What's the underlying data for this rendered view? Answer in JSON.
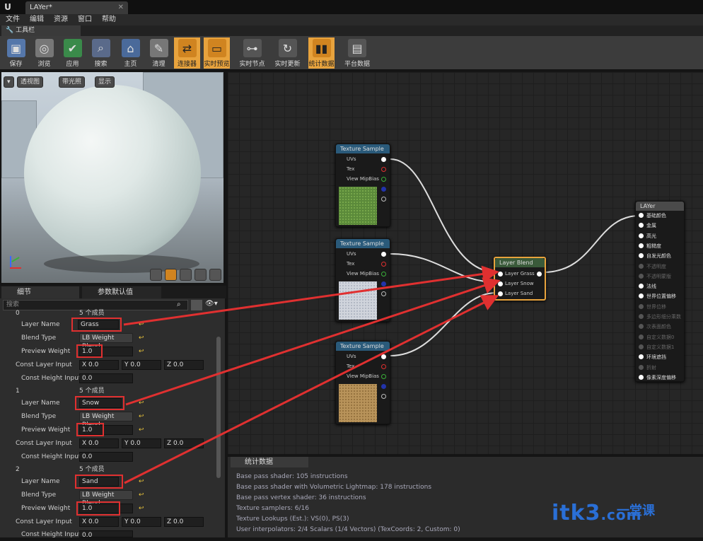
{
  "window": {
    "tab_title": "LAYer*",
    "logo": "U"
  },
  "menu": [
    "文件",
    "编辑",
    "资源",
    "窗口",
    "帮助"
  ],
  "panel_tab": "工具栏",
  "toolbar": [
    {
      "label": "保存",
      "icon": "save-icon",
      "active": false
    },
    {
      "label": "浏览",
      "icon": "browse-icon",
      "active": false
    },
    {
      "label": "应用",
      "icon": "apply-icon",
      "active": false
    },
    {
      "label": "搜索",
      "icon": "search-icon",
      "active": false
    },
    {
      "label": "主页",
      "icon": "home-icon",
      "active": false
    },
    {
      "label": "清理",
      "icon": "clean-icon",
      "active": false
    },
    {
      "label": "连接器",
      "icon": "connector-icon",
      "active": true
    },
    {
      "label": "实时预览",
      "icon": "live-preview-icon",
      "active": true
    },
    {
      "label": "实时节点",
      "icon": "live-node-icon",
      "active": false
    },
    {
      "label": "实时更新",
      "icon": "live-update-icon",
      "active": false
    },
    {
      "label": "统计数据",
      "icon": "stats-icon",
      "active": true
    },
    {
      "label": "平台数据",
      "icon": "platform-icon",
      "active": false
    }
  ],
  "viewport": {
    "perspective": "透视图",
    "lit": "带光照",
    "show": "显示"
  },
  "details_tabs": [
    "细节",
    "参数默认值"
  ],
  "search_placeholder": "搜索",
  "layers": [
    {
      "index": "0",
      "members": "5 个成员",
      "layer_name_label": "Layer Name",
      "layer_name": "Grass",
      "blend_type_label": "Blend Type",
      "blend_type": "LB Weight Blend",
      "preview_weight_label": "Preview Weight",
      "preview_weight": "1.0",
      "const_layer_label": "Const Layer Input",
      "x": "0.0",
      "y": "0.0",
      "z": "0.0",
      "const_height_label": "Const Height Input",
      "const_height": "0.0"
    },
    {
      "index": "1",
      "members": "5 个成员",
      "layer_name_label": "Layer Name",
      "layer_name": "Snow",
      "blend_type_label": "Blend Type",
      "blend_type": "LB Weight Blend",
      "preview_weight_label": "Preview Weight",
      "preview_weight": "1.0",
      "const_layer_label": "Const Layer Input",
      "x": "0.0",
      "y": "0.0",
      "z": "0.0",
      "const_height_label": "Const Height Input",
      "const_height": "0.0"
    },
    {
      "index": "2",
      "members": "5 个成员",
      "layer_name_label": "Layer Name",
      "layer_name": "Sand",
      "blend_type_label": "Blend Type",
      "blend_type": "LB Weight Blend",
      "preview_weight_label": "Preview Weight",
      "preview_weight": "1.0",
      "const_layer_label": "Const Layer Input",
      "x": "0.0",
      "y": "0.0",
      "z": "0.0",
      "const_height_label": "Const Height Input",
      "const_height": "0.0"
    }
  ],
  "axis_labels": {
    "x": "X",
    "y": "Y",
    "z": "Z"
  },
  "texture_nodes": [
    {
      "title": "Texture Sample",
      "pins": [
        "UVs",
        "Tex",
        "View MipBias"
      ],
      "swatch": "#5b8a3a"
    },
    {
      "title": "Texture Sample",
      "pins": [
        "UVs",
        "Tex",
        "View MipBias"
      ],
      "swatch": "#d0d4dc"
    },
    {
      "title": "Texture Sample",
      "pins": [
        "UVs",
        "Tex",
        "View MipBias"
      ],
      "swatch": "#b8935a"
    }
  ],
  "layer_blend_node": {
    "title": "Layer Blend",
    "pins": [
      "Layer Grass",
      "Layer Snow",
      "Layer Sand"
    ]
  },
  "material_node": {
    "title": "LAYer",
    "pins": [
      {
        "label": "基础颜色",
        "enabled": true
      },
      {
        "label": "金属",
        "enabled": true
      },
      {
        "label": "高光",
        "enabled": true
      },
      {
        "label": "粗糙度",
        "enabled": true
      },
      {
        "label": "自发光颜色",
        "enabled": true
      },
      {
        "label": "不透明度",
        "enabled": false
      },
      {
        "label": "不透明蒙版",
        "enabled": false
      },
      {
        "label": "法线",
        "enabled": true
      },
      {
        "label": "世界位置偏移",
        "enabled": true
      },
      {
        "label": "世界位移",
        "enabled": false
      },
      {
        "label": "多边形细分乘数",
        "enabled": false
      },
      {
        "label": "次表面颜色",
        "enabled": false
      },
      {
        "label": "自定义数据0",
        "enabled": false
      },
      {
        "label": "自定义数据1",
        "enabled": false
      },
      {
        "label": "环境遮挡",
        "enabled": true
      },
      {
        "label": "折射",
        "enabled": false
      },
      {
        "label": "像素深度偏移",
        "enabled": true
      }
    ]
  },
  "stats": {
    "tab": "统计数据",
    "lines": [
      "Base pass shader: 105 instructions",
      "Base pass shader with Volumetric Lightmap: 178 instructions",
      "Base pass vertex shader: 36 instructions",
      "Texture samplers: 6/16",
      "Texture Lookups (Est.): VS(0), PS(3)",
      "User interpolators: 2/4 Scalars (1/4 Vectors) (TexCoords: 2, Custom: 0)"
    ]
  },
  "watermark": {
    "latin": "itk3",
    "cn": "一堂课",
    "domain": ".com"
  },
  "colors": {
    "accent": "#e8a33d",
    "annotation_red": "#e03030",
    "graph_bg": "#262626"
  }
}
